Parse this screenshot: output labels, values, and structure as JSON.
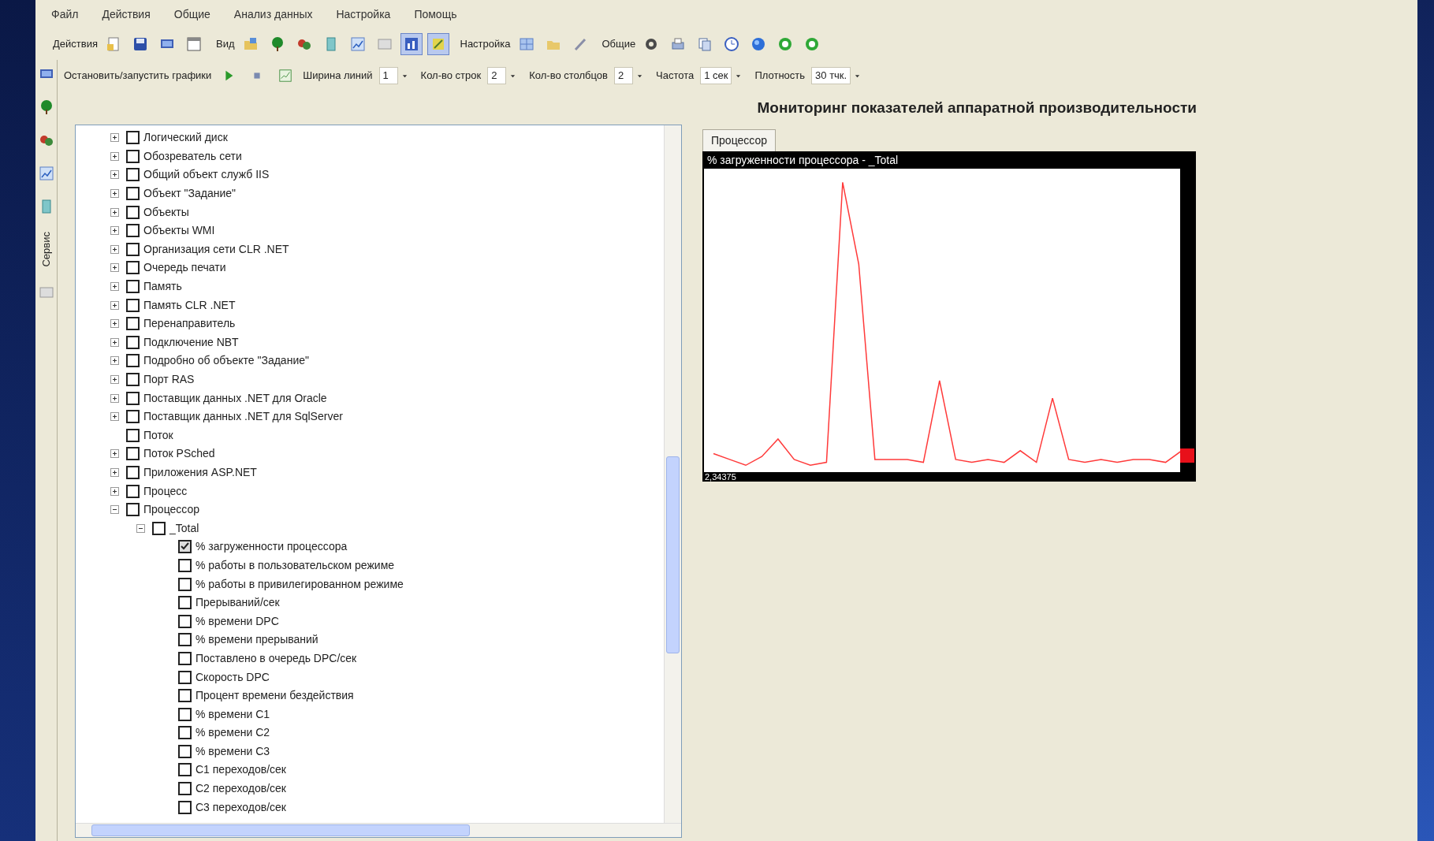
{
  "menu": [
    "Файл",
    "Действия",
    "Общие",
    "Анализ данных",
    "Настройка",
    "Помощь"
  ],
  "toolbar": [
    {
      "kind": "label",
      "text": "Действия"
    },
    {
      "kind": "button",
      "pressed": false
    },
    {
      "kind": "button",
      "pressed": false
    },
    {
      "kind": "button",
      "pressed": false
    },
    {
      "kind": "button",
      "pressed": false
    },
    {
      "kind": "label",
      "text": "Вид"
    },
    {
      "kind": "button",
      "pressed": false
    },
    {
      "kind": "button",
      "pressed": false
    },
    {
      "kind": "button",
      "pressed": false
    },
    {
      "kind": "button",
      "pressed": false
    },
    {
      "kind": "button",
      "pressed": false
    },
    {
      "kind": "button",
      "pressed": false
    },
    {
      "kind": "button",
      "pressed": true
    },
    {
      "kind": "button",
      "pressed": true
    },
    {
      "kind": "label",
      "text": "Настройка"
    },
    {
      "kind": "button",
      "pressed": false
    },
    {
      "kind": "button",
      "pressed": false
    },
    {
      "kind": "button",
      "pressed": false
    },
    {
      "kind": "label",
      "text": "Общие"
    },
    {
      "kind": "button",
      "pressed": false
    },
    {
      "kind": "button",
      "pressed": false
    },
    {
      "kind": "button",
      "pressed": false
    },
    {
      "kind": "button",
      "pressed": false
    },
    {
      "kind": "button",
      "pressed": false
    },
    {
      "kind": "button",
      "pressed": false
    },
    {
      "kind": "button",
      "pressed": false
    }
  ],
  "graph_toolbar": [
    {
      "kind": "label",
      "text": "Остановить/запустить графики"
    },
    {
      "kind": "button"
    },
    {
      "kind": "button"
    },
    {
      "kind": "button"
    },
    {
      "kind": "label",
      "text": "Ширина линий"
    },
    {
      "kind": "dropdown",
      "value": "1"
    },
    {
      "kind": "label",
      "text": "Кол-во строк"
    },
    {
      "kind": "dropdown",
      "value": "2"
    },
    {
      "kind": "label",
      "text": "Кол-во столбцов"
    },
    {
      "kind": "dropdown",
      "value": "2"
    },
    {
      "kind": "label",
      "text": "Частота"
    },
    {
      "kind": "dropdown",
      "value": "1 сек"
    },
    {
      "kind": "label",
      "text": "Плотность"
    },
    {
      "kind": "dropdown",
      "value": "30 тчк."
    }
  ],
  "side_strip": {
    "label": "Сервис"
  },
  "page_title": "Мониторинг показателей аппаратной производительности",
  "tree": [
    {
      "label": "Логический диск",
      "checked": false,
      "expanded": false
    },
    {
      "label": "Обозреватель сети",
      "checked": false,
      "expanded": false
    },
    {
      "label": "Общий объект служб IIS",
      "checked": false,
      "expanded": false
    },
    {
      "label": "Объект \"Задание\"",
      "checked": false,
      "expanded": false
    },
    {
      "label": "Объекты",
      "checked": false,
      "expanded": false
    },
    {
      "label": "Объекты WMI",
      "checked": false,
      "expanded": false
    },
    {
      "label": "Организация сети CLR .NET",
      "checked": false,
      "expanded": false
    },
    {
      "label": "Очередь печати",
      "checked": false,
      "expanded": false
    },
    {
      "label": "Память",
      "checked": false,
      "expanded": false
    },
    {
      "label": "Память CLR .NET",
      "checked": false,
      "expanded": false
    },
    {
      "label": "Перенаправитель",
      "checked": false,
      "expanded": false
    },
    {
      "label": "Подключение NBT",
      "checked": false,
      "expanded": false
    },
    {
      "label": "Подробно об объекте \"Задание\"",
      "checked": false,
      "expanded": false
    },
    {
      "label": "Порт RAS",
      "checked": false,
      "expanded": false
    },
    {
      "label": "Поставщик данных .NET для Oracle",
      "checked": false,
      "expanded": false
    },
    {
      "label": "Поставщик данных .NET для SqlServer",
      "checked": false,
      "expanded": false
    },
    {
      "label": "Поток",
      "checked": false
    },
    {
      "label": "Поток PSched",
      "checked": false,
      "expanded": false
    },
    {
      "label": "Приложения ASP.NET",
      "checked": false,
      "expanded": false
    },
    {
      "label": "Процесс",
      "checked": false,
      "expanded": false
    },
    {
      "label": "Процессор",
      "checked": false,
      "expanded": true,
      "children": [
        {
          "label": "_Total",
          "checked": false,
          "expanded": true,
          "children": [
            {
              "label": "% загруженности процессора",
              "checked": true
            },
            {
              "label": "% работы в пользовательском режиме",
              "checked": false
            },
            {
              "label": "% работы в привилегированном режиме",
              "checked": false
            },
            {
              "label": "Прерываний/сек",
              "checked": false
            },
            {
              "label": "% времени DPC",
              "checked": false
            },
            {
              "label": "% времени прерываний",
              "checked": false
            },
            {
              "label": "Поставлено в очередь DPC/сек",
              "checked": false
            },
            {
              "label": "Скорость DPC",
              "checked": false
            },
            {
              "label": "Процент времени бездействия",
              "checked": false
            },
            {
              "label": "% времени C1",
              "checked": false
            },
            {
              "label": "% времени C2",
              "checked": false
            },
            {
              "label": "% времени C3",
              "checked": false
            },
            {
              "label": "C1 переходов/сек",
              "checked": false
            },
            {
              "label": "C2 переходов/сек",
              "checked": false
            },
            {
              "label": "C3 переходов/сек",
              "checked": false
            }
          ]
        }
      ]
    }
  ],
  "tabs": [
    {
      "label": "Процессор",
      "selected": true
    }
  ],
  "graph": {
    "title": "% загруженности процессора - _Total",
    "reading": "2,34375"
  }
}
